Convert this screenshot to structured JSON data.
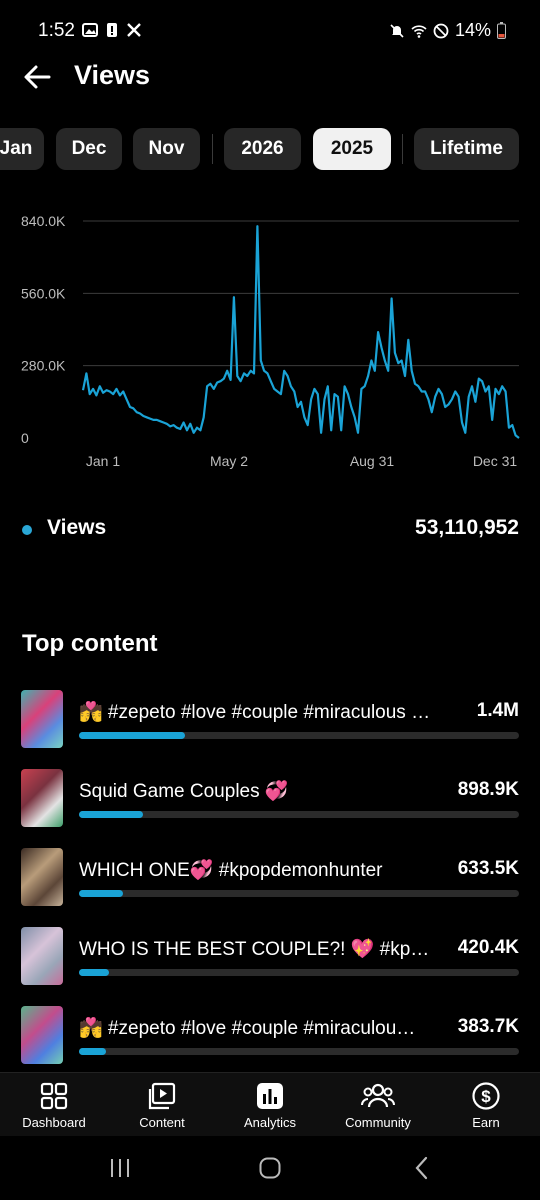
{
  "status_bar": {
    "time": "1:52",
    "battery": "14%"
  },
  "header": {
    "title": "Views"
  },
  "filters": {
    "chips": [
      "Jan",
      "Dec",
      "Nov",
      "2026",
      "2025",
      "Lifetime"
    ],
    "selected": "2025"
  },
  "chart_data": {
    "type": "line",
    "title": "",
    "xlabel": "",
    "ylabel": "",
    "x_tick_labels": [
      "Jan 1",
      "May 2",
      "Aug 31",
      "Dec 31"
    ],
    "y_tick_labels": [
      "0",
      "280.0K",
      "560.0K",
      "840.0K"
    ],
    "ylim": [
      0,
      840000
    ],
    "grid": true,
    "color": "#1aa3d6",
    "series": [
      {
        "values": [
          185000,
          250000,
          170000,
          190000,
          165000,
          200000,
          175000,
          185000,
          180000,
          170000,
          190000,
          165000,
          180000,
          150000,
          120000,
          115000,
          100000,
          95000,
          85000,
          80000,
          75000,
          70000,
          70000,
          65000,
          60000,
          55000,
          45000,
          50000,
          40000,
          35000,
          60000,
          30000,
          55000,
          20000,
          40000,
          30000,
          80000,
          200000,
          210000,
          190000,
          215000,
          220000,
          230000,
          260000,
          225000,
          545000,
          240000,
          220000,
          250000,
          240000,
          260000,
          250000,
          820000,
          300000,
          260000,
          250000,
          220000,
          190000,
          180000,
          170000,
          260000,
          240000,
          200000,
          180000,
          120000,
          140000,
          80000,
          50000,
          150000,
          190000,
          170000,
          20000,
          150000,
          200000,
          30000,
          170000,
          160000,
          30000,
          200000,
          170000,
          120000,
          80000,
          20000,
          190000,
          200000,
          240000,
          300000,
          260000,
          410000,
          350000,
          300000,
          260000,
          540000,
          330000,
          290000,
          300000,
          240000,
          380000,
          260000,
          210000,
          200000,
          180000,
          180000,
          150000,
          100000,
          160000,
          190000,
          170000,
          120000,
          130000,
          150000,
          180000,
          160000,
          60000,
          20000,
          160000,
          200000,
          140000,
          230000,
          220000,
          180000,
          200000,
          70000,
          190000,
          170000,
          200000,
          180000,
          40000,
          50000,
          10000,
          0
        ]
      }
    ]
  },
  "summary": {
    "label": "Views",
    "value": "53,110,952"
  },
  "top_content": {
    "title": "Top content",
    "items": [
      {
        "title": "💏 #zepeto #love #couple #miraculous …",
        "value": "1.4M",
        "progress": 0.24
      },
      {
        "title": "Squid Game Couples 💞",
        "value": "898.9K",
        "progress": 0.145
      },
      {
        "title": "WHICH ONE💞 #kpopdemonhunter",
        "value": "633.5K",
        "progress": 0.1
      },
      {
        "title": "WHO IS THE BEST COUPLE?! 💖 #kpo…",
        "value": "420.4K",
        "progress": 0.068
      },
      {
        "title": "💏 #zepeto #love #couple #miraculou…",
        "value": "383.7K",
        "progress": 0.062
      }
    ]
  },
  "bottom_nav": {
    "items": [
      "Dashboard",
      "Content",
      "Analytics",
      "Community",
      "Earn"
    ]
  }
}
